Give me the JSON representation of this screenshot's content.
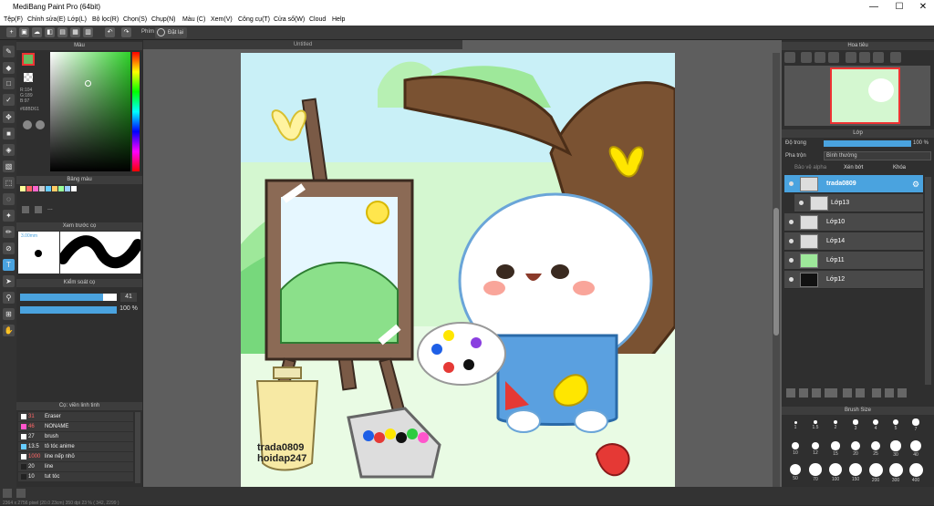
{
  "window": {
    "title": "MediBang Paint Pro (64bit)",
    "min": "—",
    "max": "☐",
    "close": "✕"
  },
  "menu": [
    "Tệp(F)",
    "Chỉnh sửa(E)",
    "Lớp(L)",
    "Bộ lọc(R)",
    "Chọn(S)",
    "Chụp(N)",
    "Màu (C)",
    "Xem(V)",
    "Công cụ(T)",
    "Cửa sổ(W)",
    "Cloud",
    "Help"
  ],
  "toolbar": {
    "phim_label": "Phím",
    "reset_label": "Đặt lại"
  },
  "color_panel": {
    "title": "Màu",
    "r": "R:104",
    "g": "G:189",
    "b": "B:97",
    "hex": "#68BD61"
  },
  "palette_panel": {
    "title": "Bảng màu",
    "colors": [
      "#ff9",
      "#f66",
      "#f6c",
      "#ccc",
      "#6cf",
      "#fc6",
      "#9f9",
      "#9cf",
      "#fff"
    ],
    "more": "..."
  },
  "brush_preview": {
    "title": "Xem trước cọ",
    "size": "3.00mm"
  },
  "brush_control": {
    "title": "Kiểm soát cọ",
    "size": "41",
    "opacity": "100 %",
    "size_fill": 0.86,
    "opacity_fill": 1.0
  },
  "brush_list": {
    "title": "Cọ: viền linh tinh",
    "items": [
      {
        "num": "31",
        "label": "Eraser",
        "color": "#ffffff"
      },
      {
        "num": "46",
        "label": "NONAME",
        "color": "#f5c"
      },
      {
        "num": "27",
        "label": "brush",
        "color": "#ffffff"
      },
      {
        "num": "13.5",
        "label": "tô tóc anime",
        "color": "#6cf"
      },
      {
        "num": "1000",
        "label": "line nếp nhỏ",
        "color": "#ffffff"
      },
      {
        "num": "20",
        "label": "line",
        "color": "#222"
      },
      {
        "num": "10",
        "label": "tut tóc",
        "color": "#222"
      }
    ]
  },
  "canvas": {
    "tab": "Untitled",
    "signature1": "trada0809",
    "signature2": "hoidap247"
  },
  "navigator": {
    "title": "Hoa tiêu"
  },
  "layers": {
    "title": "Lớp",
    "opacity_label": "Độ trong",
    "opacity": "100 %",
    "blend_label": "Pha trộn",
    "blend": "Bình thường",
    "protect_alpha": "Bảo vệ alpha",
    "clip": "Xén bớt",
    "lock": "Khóa",
    "items": [
      {
        "name": "trada0809",
        "active": true
      },
      {
        "name": "Lớp13"
      },
      {
        "name": "Lớp10"
      },
      {
        "name": "Lớp14"
      },
      {
        "name": "Lớp11"
      },
      {
        "name": "Lớp12"
      }
    ]
  },
  "brush_size": {
    "title": "Brush Size",
    "sizes": [
      "1",
      "1.5",
      "2",
      "3",
      "4",
      "5",
      "7",
      "10",
      "12",
      "15",
      "20",
      "25",
      "30",
      "40",
      "50",
      "70",
      "100",
      "150",
      "200",
      "300",
      "400"
    ]
  },
  "status": {
    "text": "2364 x 2756 pixel  (20.0 23cm)  350 dpi  23 %  ( 342, 2299 )"
  },
  "theme": {
    "accent": "#4aa3df",
    "panel": "#2f2f2f",
    "canvas_bg": "#5e5e5e"
  }
}
